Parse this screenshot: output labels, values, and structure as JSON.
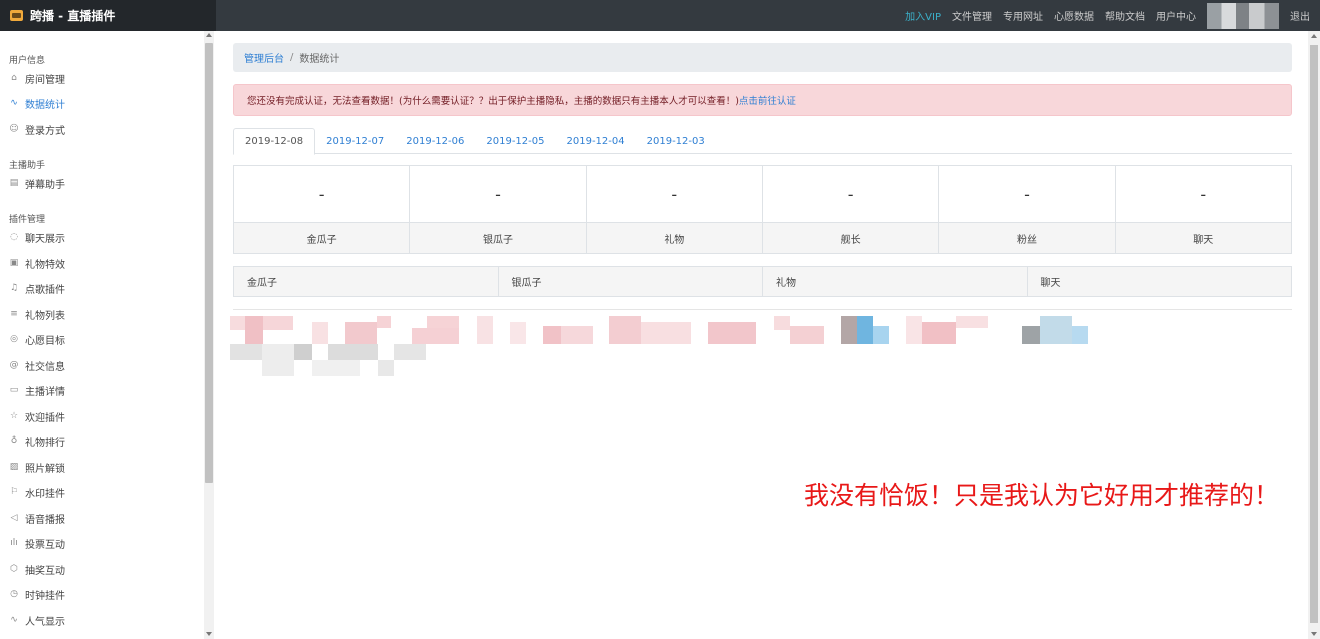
{
  "app": {
    "title": "跨播 - 直播插件"
  },
  "topnav": {
    "items": [
      {
        "label": "加入VIP",
        "highlight": true
      },
      {
        "label": "文件管理"
      },
      {
        "label": "专用网址"
      },
      {
        "label": "心愿数据"
      },
      {
        "label": "帮助文档"
      },
      {
        "label": "用户中心"
      }
    ],
    "logout": "退出"
  },
  "sidebar": {
    "groups": [
      {
        "title": "用户信息",
        "items": [
          {
            "label": "房间管理",
            "icon": "home-icon"
          },
          {
            "label": "数据统计",
            "icon": "pulse-icon",
            "active": true
          },
          {
            "label": "登录方式",
            "icon": "users-icon"
          }
        ]
      },
      {
        "title": "主播助手",
        "items": [
          {
            "label": "弹幕助手",
            "icon": "layout-icon"
          }
        ]
      },
      {
        "title": "插件管理",
        "items": [
          {
            "label": "聊天展示",
            "icon": "chat-bubble-icon"
          },
          {
            "label": "礼物特效",
            "icon": "gift-icon"
          },
          {
            "label": "点歌插件",
            "icon": "music-icon"
          },
          {
            "label": "礼物列表",
            "icon": "list-icon"
          },
          {
            "label": "心愿目标",
            "icon": "target-icon"
          },
          {
            "label": "社交信息",
            "icon": "at-icon"
          },
          {
            "label": "主播详情",
            "icon": "card-icon"
          },
          {
            "label": "欢迎插件",
            "icon": "star-icon"
          },
          {
            "label": "礼物排行",
            "icon": "award-icon"
          },
          {
            "label": "照片解锁",
            "icon": "image-icon"
          },
          {
            "label": "水印挂件",
            "icon": "flag-icon"
          },
          {
            "label": "语音播报",
            "icon": "volume-icon"
          },
          {
            "label": "投票互动",
            "icon": "bar-chart-icon"
          },
          {
            "label": "抽奖互动",
            "icon": "box-icon"
          },
          {
            "label": "时钟挂件",
            "icon": "clock-icon"
          },
          {
            "label": "人气显示",
            "icon": "activity-icon"
          }
        ]
      }
    ]
  },
  "breadcrumb": {
    "home": "管理后台",
    "separator": "/",
    "current": "数据统计"
  },
  "alert": {
    "message": "您还没有完成认证，无法查看数据！(为什么需要认证？？出于保护主播隐私，主播的数据只有主播本人才可以查看！)",
    "link": "点击前往认证"
  },
  "tabs": [
    "2019-12-08",
    "2019-12-07",
    "2019-12-06",
    "2019-12-05",
    "2019-12-04",
    "2019-12-03"
  ],
  "stats": [
    {
      "value": "-",
      "label": "金瓜子"
    },
    {
      "value": "-",
      "label": "银瓜子"
    },
    {
      "value": "-",
      "label": "礼物"
    },
    {
      "value": "-",
      "label": "舰长"
    },
    {
      "value": "-",
      "label": "粉丝"
    },
    {
      "value": "-",
      "label": "聊天"
    }
  ],
  "table": {
    "headers": [
      "金瓜子",
      "银瓜子",
      "礼物",
      "聊天"
    ]
  },
  "annotation": "我没有恰饭！只是我认为它好用才推荐的！",
  "colors": {
    "accent": "#2f7fd3",
    "topbar": "#343a40",
    "alert_bg": "#f8d7da",
    "annotation": "#e81818"
  }
}
